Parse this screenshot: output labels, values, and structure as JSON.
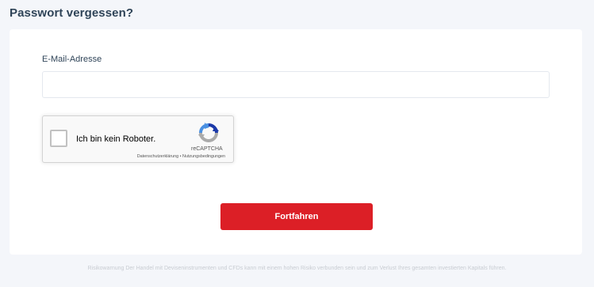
{
  "page": {
    "title": "Passwort vergessen?"
  },
  "form": {
    "email_label": "E-Mail-Adresse",
    "email_value": "",
    "email_placeholder": "",
    "submit_label": "Fortfahren"
  },
  "recaptcha": {
    "label": "Ich bin kein Roboter.",
    "brand": "reCAPTCHA",
    "privacy_link": "Datenschutzerklärung",
    "separator": "•",
    "terms_link": "Nutzungsbedingungen",
    "checked": false,
    "icon": "recaptcha-logo-icon"
  },
  "footer": {
    "risk_warning": "Risikowarnung Der Handel mit Deviseninstrumenten und CFDs kann mit einem hohen Risiko verbunden sein und zum Verlust Ihres gesamten investierten Kapitals führen."
  },
  "colors": {
    "background": "#f4f6fa",
    "title": "#2f4458",
    "button": "#dc1f26",
    "recaptcha_blue": "#1c3aa9",
    "recaptcha_light_blue": "#4a90e2",
    "recaptcha_gray": "#aaaaaa"
  }
}
